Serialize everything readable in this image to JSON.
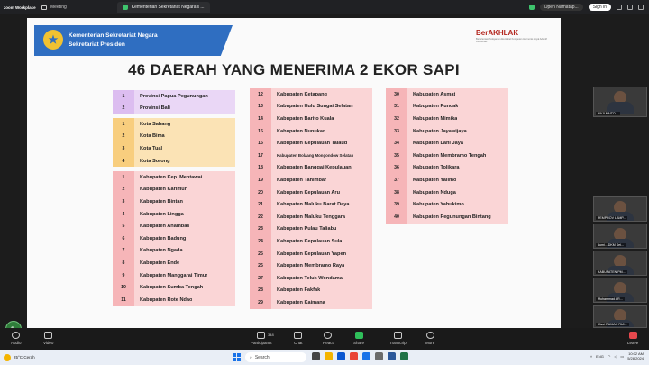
{
  "topbar": {
    "app_name": "zoom Workplace",
    "tabs": [
      {
        "label": "Meeting",
        "active": false
      },
      {
        "label": "Kementerian Sekretariat Negara's ...",
        "active": true
      }
    ],
    "notes_label": "Open Namatap...",
    "signin_label": "Sign in"
  },
  "slide": {
    "org_line1": "Kementerian Sekretariat Negara",
    "org_line2": "Sekretariat Presiden",
    "brand": "BerAKHLAK",
    "brand_sub": "Berorientasi Pelayanan Akuntabel Kompeten Harmonis Loyal Adaptif Kolaboratif",
    "title": "46 DAERAH YANG MENERIMA 2 EKOR SAPI",
    "provinsi": [
      {
        "no": "1",
        "name": "Provinsi Papua Pegunungan"
      },
      {
        "no": "2",
        "name": "Provinsi Bali"
      }
    ],
    "kota": [
      {
        "no": "1",
        "name": "Kota Sabang"
      },
      {
        "no": "2",
        "name": "Kota Bima"
      },
      {
        "no": "3",
        "name": "Kota Tual"
      },
      {
        "no": "4",
        "name": "Kota Sorong"
      }
    ],
    "kab_col1": [
      {
        "no": "1",
        "name": "Kabupaten Kep. Mentawai"
      },
      {
        "no": "2",
        "name": "Kabupaten Karimun"
      },
      {
        "no": "3",
        "name": "Kabupaten Bintan"
      },
      {
        "no": "4",
        "name": "Kabupaten Lingga"
      },
      {
        "no": "5",
        "name": "Kabupaten Anambas"
      },
      {
        "no": "6",
        "name": "Kabupaten Badung"
      },
      {
        "no": "7",
        "name": "Kabupaten Ngada"
      },
      {
        "no": "8",
        "name": "Kabupaten Ende"
      },
      {
        "no": "9",
        "name": "Kabupaten Manggarai Timur"
      },
      {
        "no": "10",
        "name": "Kabupaten Sumba Tengah"
      },
      {
        "no": "11",
        "name": "Kabupaten Rote Ndao"
      }
    ],
    "kab_col2": [
      {
        "no": "12",
        "name": "Kabupaten Ketapang"
      },
      {
        "no": "13",
        "name": "Kabupaten Hulu Sungai Selatan"
      },
      {
        "no": "14",
        "name": "Kabupaten Barito Kuala"
      },
      {
        "no": "15",
        "name": "Kabupaten Nunukan"
      },
      {
        "no": "16",
        "name": "Kabupaten Kepulauan Talaud"
      },
      {
        "no": "17",
        "name": "Kabupaten Bolaang Mongondow Selatan"
      },
      {
        "no": "18",
        "name": "Kabupaten Banggai Kepulauan"
      },
      {
        "no": "19",
        "name": "Kabupaten Tanimbar"
      },
      {
        "no": "20",
        "name": "Kabupaten Kepulauan Aru"
      },
      {
        "no": "21",
        "name": "Kabupaten Maluku Barat Daya"
      },
      {
        "no": "22",
        "name": "Kabupaten Maluku Tenggara"
      },
      {
        "no": "23",
        "name": "Kabupaten Pulau Taliabu"
      },
      {
        "no": "24",
        "name": "Kabupaten Kepulauan Sula"
      },
      {
        "no": "25",
        "name": "Kabupaten  Kepulauan Yapen"
      },
      {
        "no": "26",
        "name": "Kabupaten Membramo Raya"
      },
      {
        "no": "27",
        "name": "Kabupaten Teluk Wondama"
      },
      {
        "no": "28",
        "name": "Kabupaten Fakfak"
      },
      {
        "no": "29",
        "name": "Kabupaten Kaimana"
      }
    ],
    "kab_col3": [
      {
        "no": "30",
        "name": "Kabupaten Asmat"
      },
      {
        "no": "31",
        "name": "Kabupaten Puncak"
      },
      {
        "no": "32",
        "name": "Kabupaten Mimika"
      },
      {
        "no": "33",
        "name": "Kabupaten Jayawijaya"
      },
      {
        "no": "34",
        "name": "Kabupaten Lani Jaya"
      },
      {
        "no": "35",
        "name": "Kabupaten Membramo Tengah"
      },
      {
        "no": "36",
        "name": "Kabupaten Tolikara"
      },
      {
        "no": "37",
        "name": "Kabupaten Yalimo"
      },
      {
        "no": "38",
        "name": "Kabupaten Nduga"
      },
      {
        "no": "39",
        "name": "Kabupaten Yahukimo"
      },
      {
        "no": "40",
        "name": "Kabupaten Pegunungan Bintang"
      }
    ]
  },
  "participants": [
    {
      "label": "HAJI NAITO..."
    },
    {
      "label": "PEMPROV LAMP..."
    },
    {
      "label": "Lumi... DKM Sei..."
    },
    {
      "label": "KABUPATEN PM..."
    },
    {
      "label": "Muhammad AR..."
    },
    {
      "label": "Uisut RUMAH RUI..."
    }
  ],
  "toolbar": {
    "audio": "Audio",
    "video": "Video",
    "participants": "Participants",
    "participants_count": "348",
    "chat": "Chat",
    "react": "React",
    "share": "Share",
    "transcript": "Transcript",
    "more": "More",
    "leave": "Leave"
  },
  "taskbar": {
    "weather_temp": "25°C",
    "weather_desc": "Cerah",
    "search_placeholder": "Search",
    "lang": "ENG",
    "time": "10:02 AM",
    "date": "5/28/2024"
  },
  "colors": {
    "banner_blue": "#2f6ec1",
    "provinsi_bg": "#ead7f6",
    "kota_bg": "#fbe3b5",
    "kab_bg": "#fad5d6",
    "brand_red": "#b3261e"
  }
}
